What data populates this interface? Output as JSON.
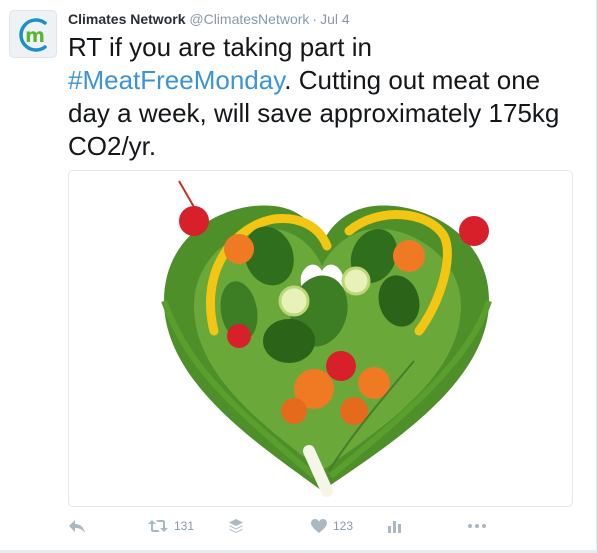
{
  "tweet": {
    "author_name": "Climates Network",
    "author_handle": "@ClimatesNetwork",
    "separator": "·",
    "timestamp": "Jul 4",
    "avatar_letter": "m",
    "text_before": "RT if you are taking part in ",
    "hashtag": "#MeatFreeMonday",
    "text_after": ". Cutting out meat one day a week, will save approximately 175kg CO2/yr.",
    "media_description_icon": "vegetable-heart-image"
  },
  "actions": {
    "retweet_count": "131",
    "like_count": "123"
  },
  "colors": {
    "hashtag": "#3b94d9",
    "meta_gray": "#8899a6",
    "avatar_blue": "#1a8fc9",
    "avatar_green": "#5bb531"
  }
}
